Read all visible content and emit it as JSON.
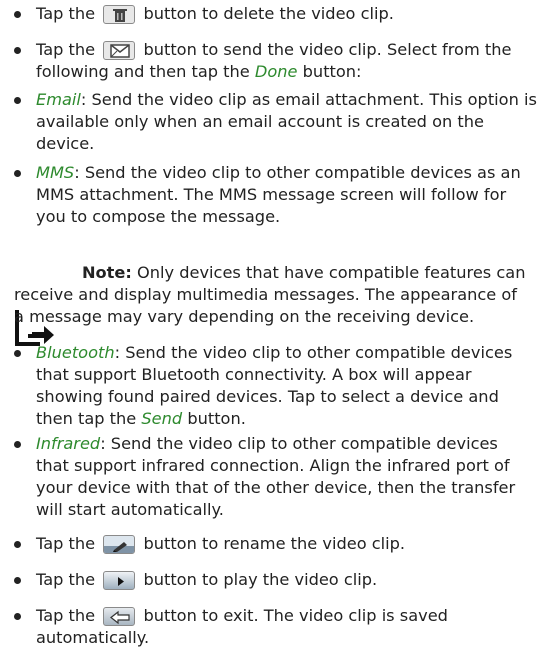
{
  "items": {
    "delete": {
      "pre": "Tap the",
      "post": "button to delete the video clip.",
      "icon": "trash-icon"
    },
    "send": {
      "pre": "Tap the",
      "post": "button to send the video clip. Select from the",
      "line2_pre": "following and then tap the",
      "line2_link": "Done",
      "line2_post": "button:",
      "icon": "envelope-icon"
    },
    "email": {
      "label": "Email",
      "line1": ": Send the video clip as email attachment. This option is",
      "line2": "available only when an email account is created on the",
      "line3": "device."
    },
    "mms": {
      "label": "MMS",
      "line1": ": Send the video clip to other compatible devices as an",
      "line2": "MMS attachment. The MMS message screen will follow for",
      "line3": "you to compose the message."
    },
    "note": {
      "label": "Note:",
      "line1": "Only devices that have compatible features can",
      "line2": "receive and display multimedia messages. The appearance of",
      "line3": "a message may vary depending on the receiving device."
    },
    "bluetooth": {
      "label": "Bluetooth",
      "line1": ": Send the video clip to other compatible devices",
      "line2": "that support Bluetooth connectivity. A box will appear",
      "line3": "showing found paired devices. Tap to select a device and",
      "line4_pre": "then tap the",
      "line4_link": "Send",
      "line4_post": "button."
    },
    "infrared": {
      "label": "Infrared",
      "line1": ": Send the video clip to other compatible devices",
      "line2": "that support infrared connection. Align the infrared port of",
      "line3": "your device with that of the other device, then the transfer",
      "line4": "will start automatically."
    },
    "rename": {
      "pre": "Tap the",
      "post": "button to rename the video clip.",
      "icon": "rename-icon"
    },
    "play": {
      "pre": "Tap the",
      "post": "button to play the video clip.",
      "icon": "play-icon"
    },
    "exit": {
      "pre": "Tap the",
      "post": "button to exit. The video clip is saved",
      "line2": "automatically.",
      "icon": "back-arrow-icon"
    }
  },
  "colors": {
    "link": "#2e8a2e",
    "text": "#222222"
  }
}
